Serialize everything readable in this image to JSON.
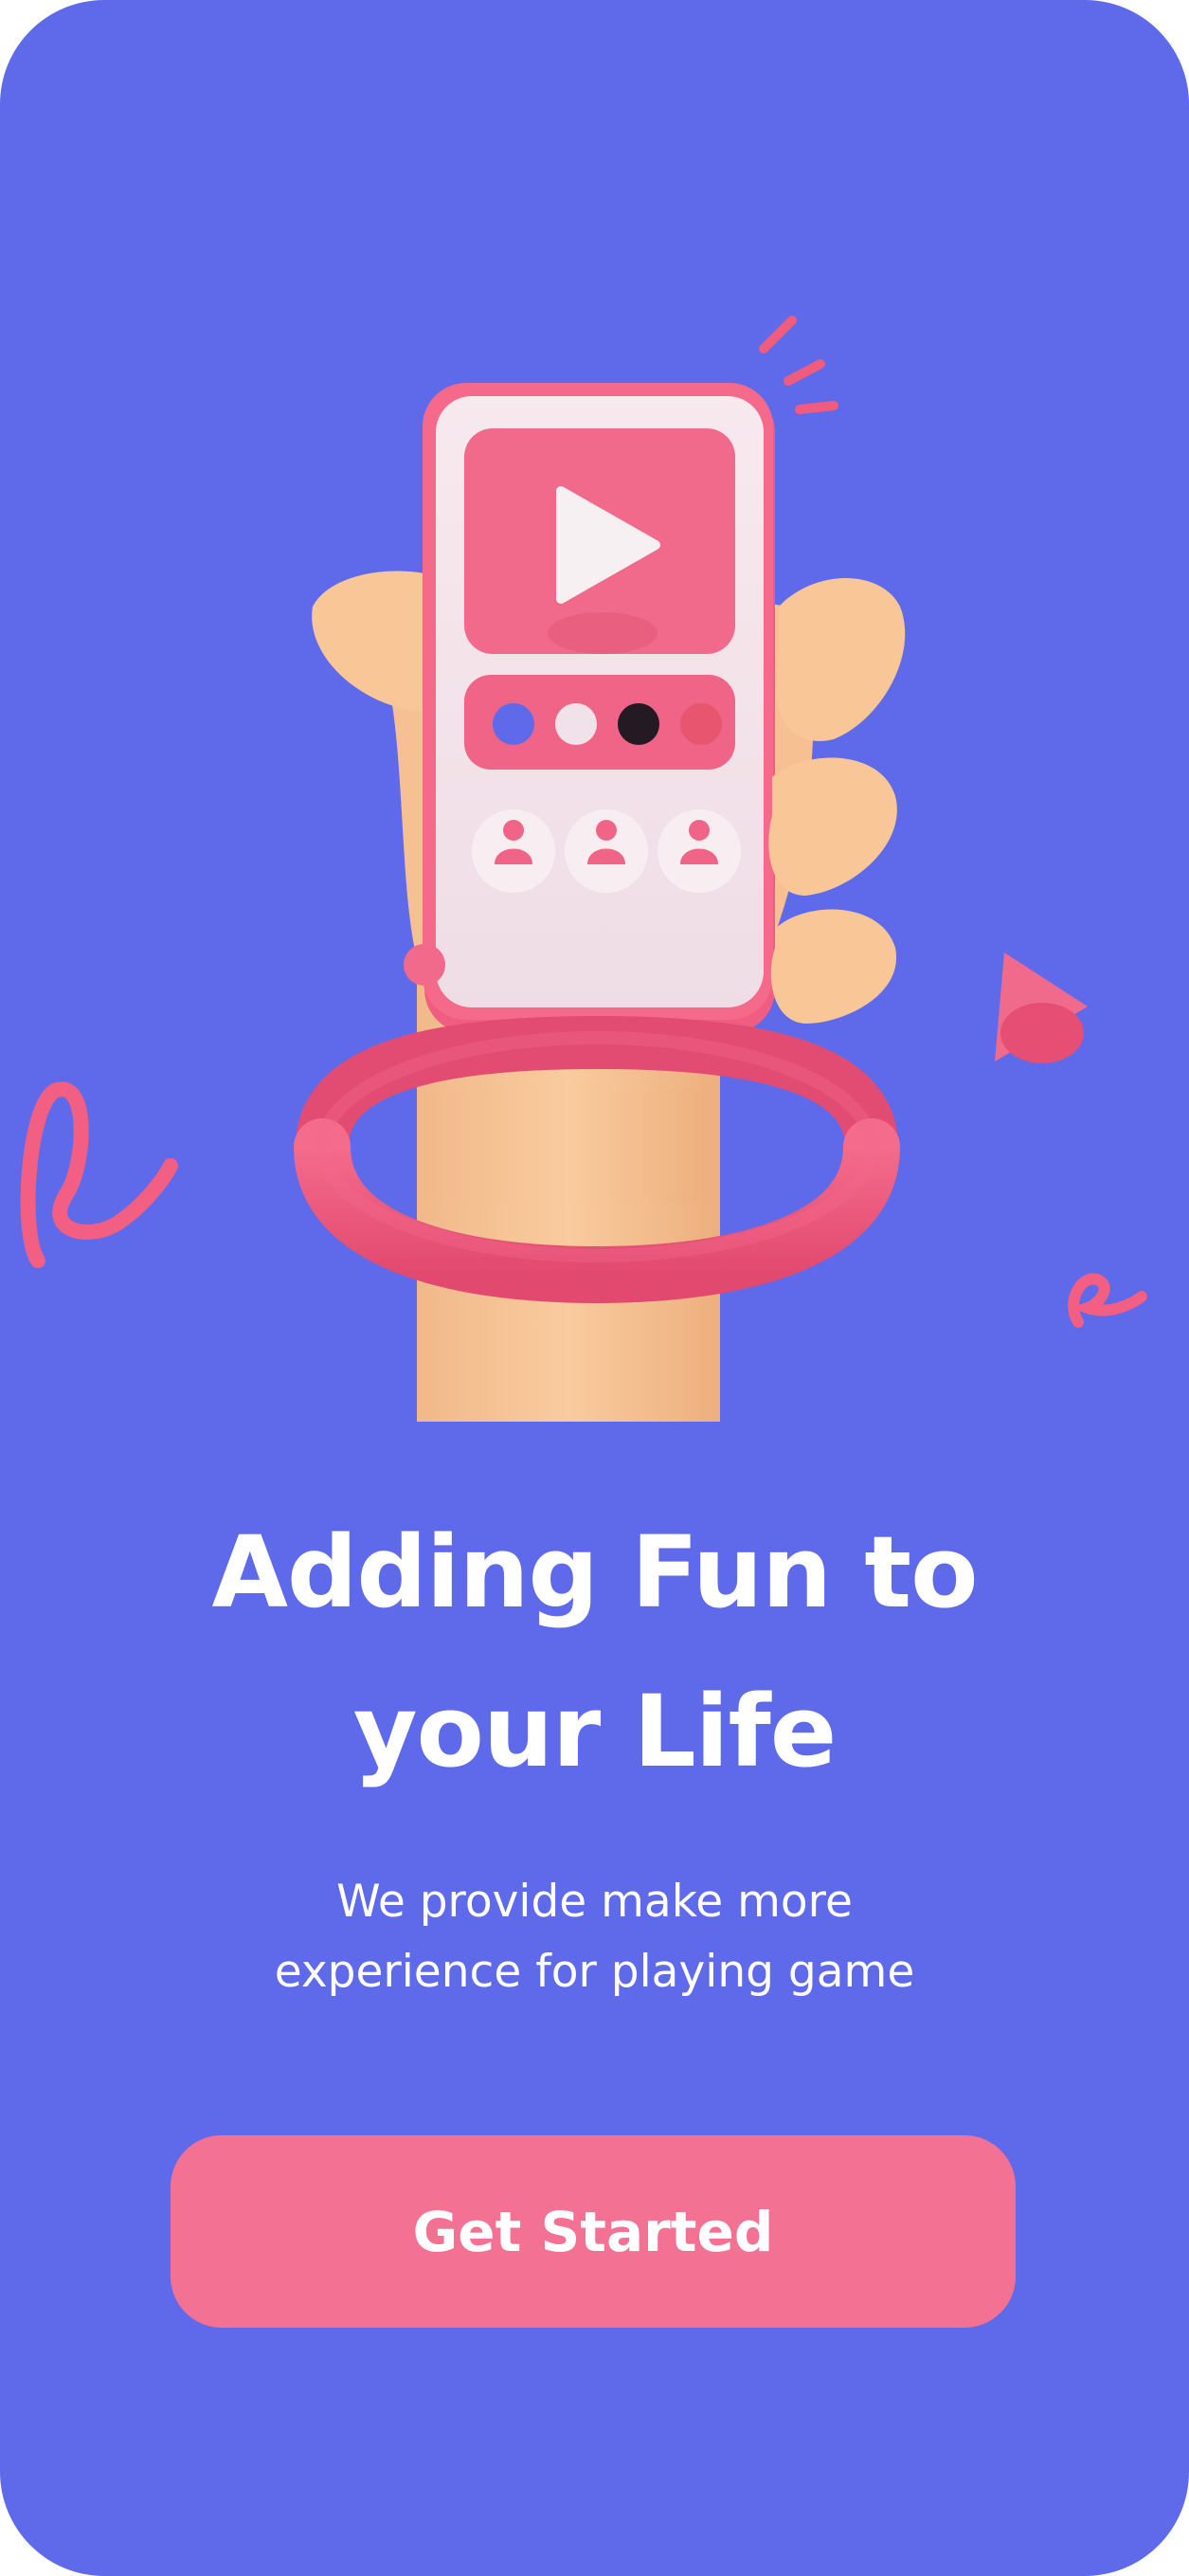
{
  "onboarding": {
    "headline": "Adding Fun to your Life",
    "description": "We provide make more\nexperience for  playing game",
    "cta_label": "Get Started"
  },
  "colors": {
    "background": "#5F6AEB",
    "accent_pink": "#F37193",
    "text": "#FFFFFF"
  },
  "illustration": {
    "icons": [
      "play-icon",
      "user-icon"
    ],
    "color_swatches": [
      "#5F6AEB",
      "#F0E2E8",
      "#231A24",
      "#E8556E"
    ]
  }
}
